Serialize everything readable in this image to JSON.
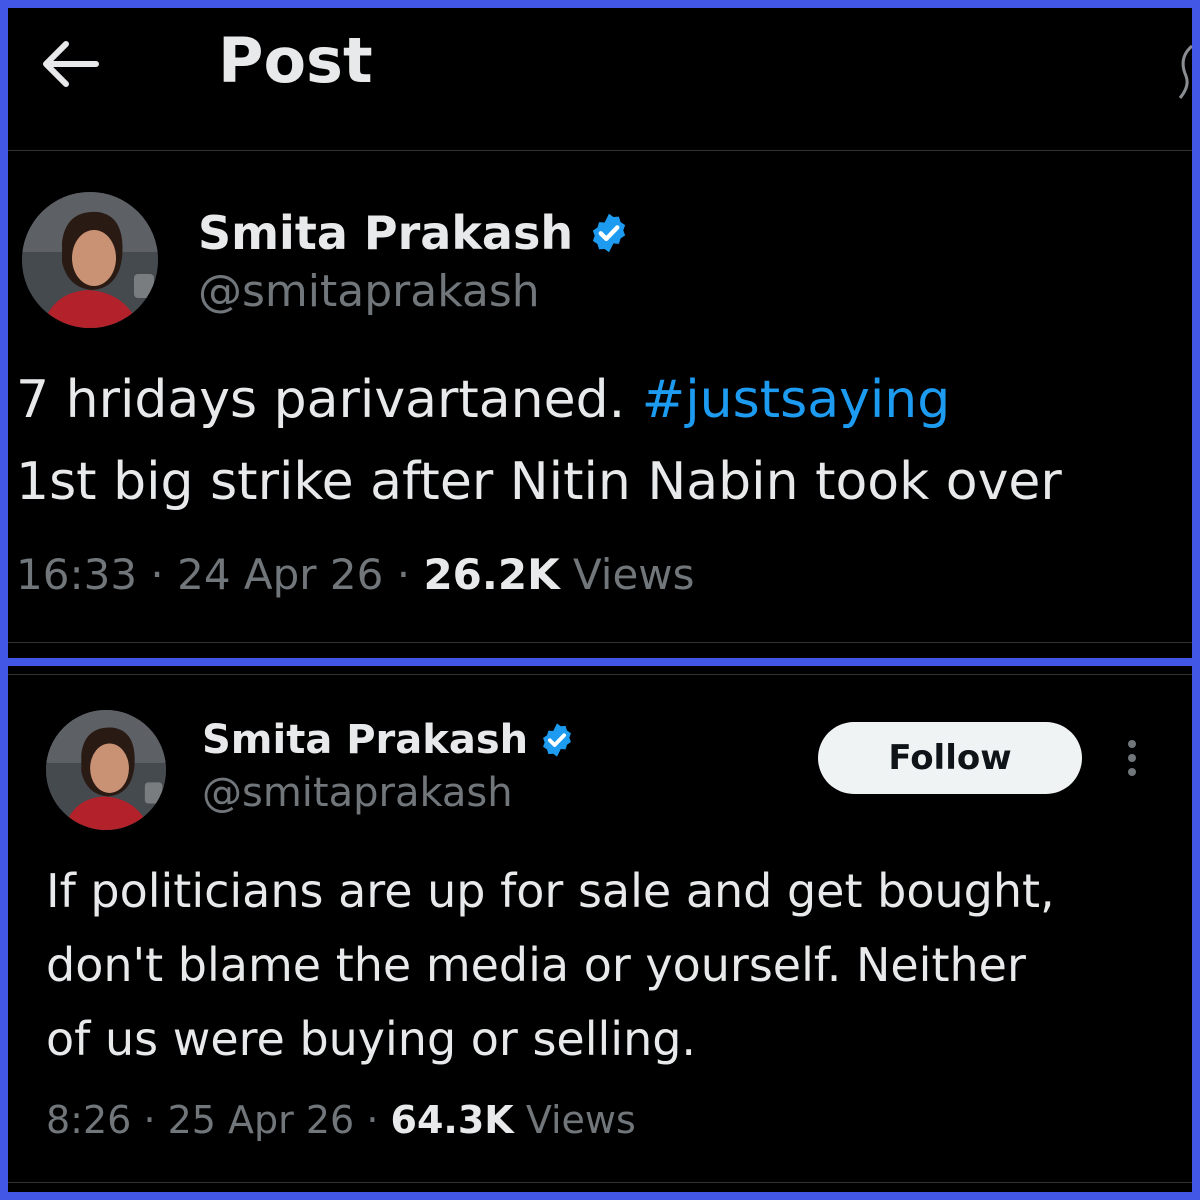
{
  "header": {
    "title": "Post",
    "back_icon": "arrow-left-icon"
  },
  "tweets": [
    {
      "author_name": "Smita Prakash",
      "author_handle": "@smitaprakash",
      "verified_icon": "verified-badge-icon",
      "text_line1": "7 hridays parivartaned. ",
      "hashtag": "#justsaying",
      "text_line2": "1st big strike after Nitin Nabin took over",
      "time": "16:33",
      "date": "24 Apr 26",
      "views_count": "26.2K",
      "views_label": "Views",
      "separator": "·"
    },
    {
      "author_name": "Smita Prakash",
      "author_handle": "@smitaprakash",
      "verified_icon": "verified-badge-icon",
      "follow_label": "Follow",
      "more_icon": "more-vertical-icon",
      "text_line1": "If politicians are up for sale and get bought,",
      "text_line2": "don't blame the media or yourself. Neither",
      "text_line3": "of us were buying or selling.",
      "time": "8:26",
      "date": "25 Apr 26",
      "views_count": "64.3K",
      "views_label": "Views",
      "separator": "·"
    }
  ],
  "colors": {
    "frame": "#4257e6",
    "background": "#000000",
    "text": "#e7e9ea",
    "secondary": "#71767b",
    "link": "#1d9bf0",
    "verified": "#1d9bf0"
  }
}
